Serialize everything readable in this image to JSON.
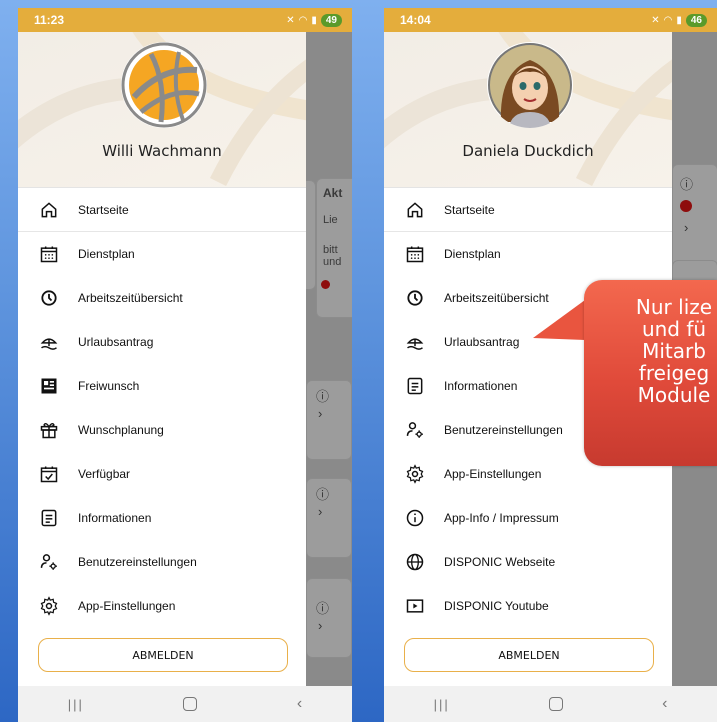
{
  "left_phone": {
    "status": {
      "time": "11:23",
      "battery": "49"
    },
    "user_name": "Willi Wachmann",
    "menu": [
      {
        "label": "Startseite",
        "icon": "home-icon"
      },
      {
        "label": "Dienstplan",
        "icon": "calendar-icon"
      },
      {
        "label": "Arbeitszeitübersicht",
        "icon": "clock-icon"
      },
      {
        "label": "Urlaubsantrag",
        "icon": "vacation-icon"
      },
      {
        "label": "Freiwunsch",
        "icon": "freiwunsch-icon"
      },
      {
        "label": "Wunschplanung",
        "icon": "gift-icon"
      },
      {
        "label": "Verfügbar",
        "icon": "calendar-check-icon"
      },
      {
        "label": "Informationen",
        "icon": "document-icon"
      },
      {
        "label": "Benutzereinstellungen",
        "icon": "user-settings-icon"
      },
      {
        "label": "App-Einstellungen",
        "icon": "gear-icon"
      }
    ],
    "logout_label": "ABMELDEN",
    "background": {
      "card_title": "Akt",
      "line1": "Lie",
      "line2": "bitt",
      "line3": "und"
    }
  },
  "right_phone": {
    "status": {
      "time": "14:04",
      "battery": "46"
    },
    "user_name": "Daniela Duckdich",
    "menu": [
      {
        "label": "Startseite",
        "icon": "home-icon"
      },
      {
        "label": "Dienstplan",
        "icon": "calendar-icon"
      },
      {
        "label": "Arbeitszeitübersicht",
        "icon": "clock-icon"
      },
      {
        "label": "Urlaubsantrag",
        "icon": "vacation-icon"
      },
      {
        "label": "Informationen",
        "icon": "document-icon"
      },
      {
        "label": "Benutzereinstellungen",
        "icon": "user-settings-icon"
      },
      {
        "label": "App-Einstellungen",
        "icon": "gear-icon"
      },
      {
        "label": "App-Info / Impressum",
        "icon": "info-icon"
      },
      {
        "label": "DISPONIC Webseite",
        "icon": "globe-icon"
      },
      {
        "label": "DISPONIC Youtube",
        "icon": "youtube-icon"
      }
    ],
    "logout_label": "ABMELDEN"
  },
  "callout": {
    "text": "Nur lize\nund fü\nMitarb\nfreigeg\nModule"
  },
  "colors": {
    "status_bar": "#e4ad3c",
    "accent_border": "#e9b04a",
    "callout": "#e04a3a"
  }
}
